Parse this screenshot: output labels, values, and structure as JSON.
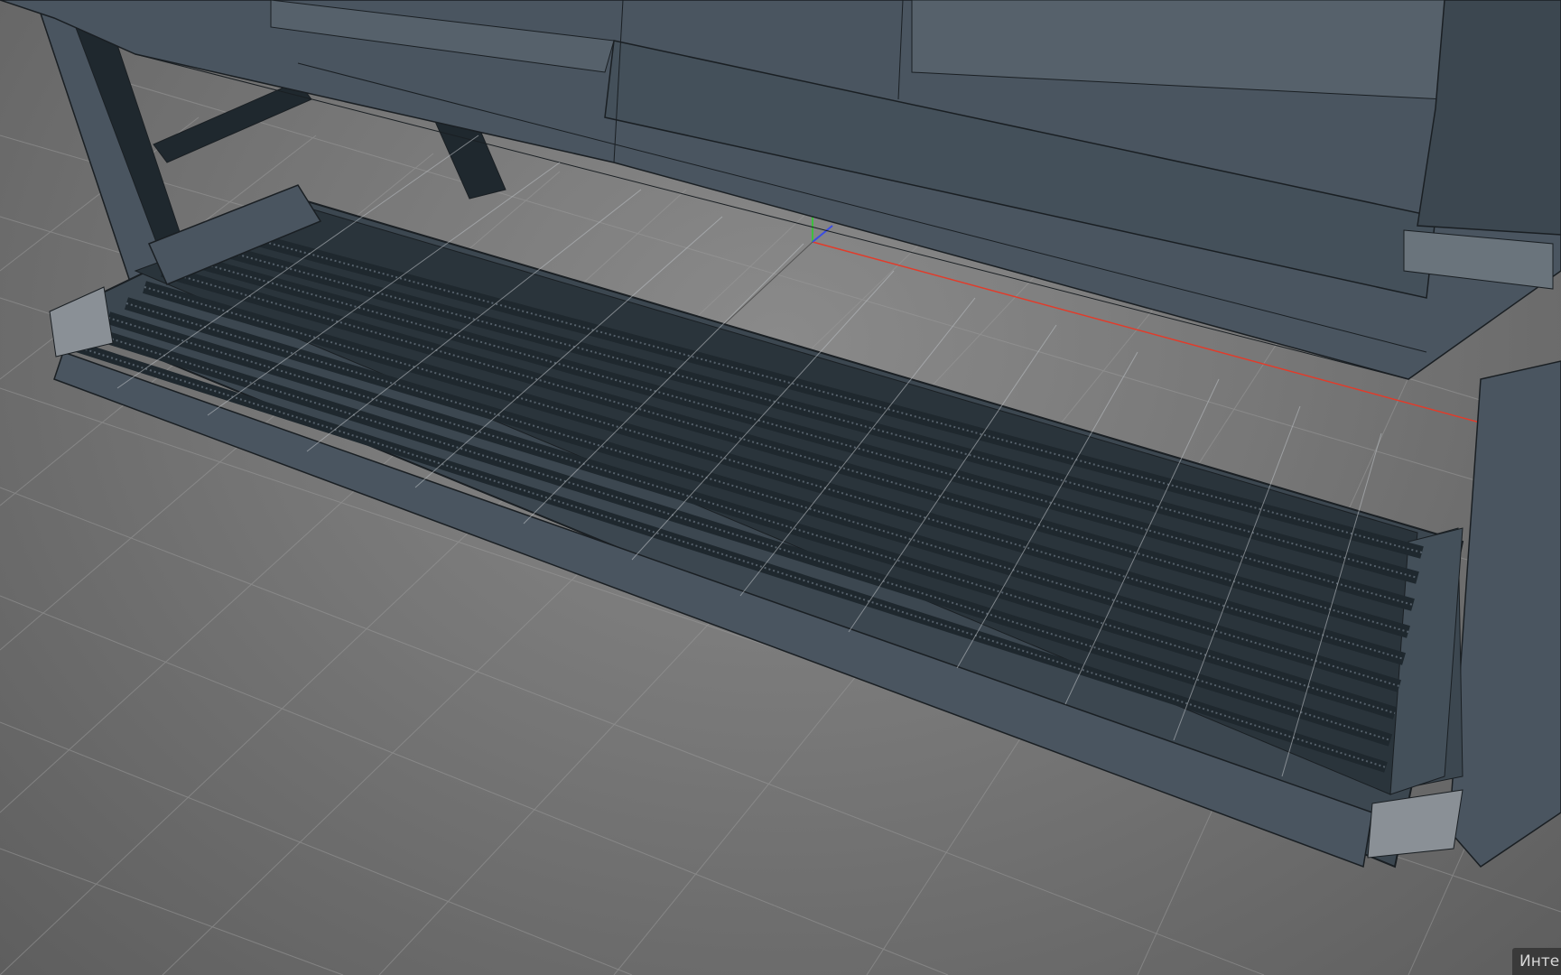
{
  "app": {
    "viewport": {
      "background_color": "#7a7a7a",
      "mesh_color": "#4a5560",
      "mesh_dark_color": "#1f282e",
      "wire_color": "#1a1f23",
      "grid_color": "#9a9a9a",
      "axis": {
        "x_color": "#e23b2a",
        "y_color": "#3fbf3f",
        "z_color": "#3b4de2"
      }
    },
    "status": {
      "label": "Инте"
    },
    "icons": {
      "axis_gizmo": "axis-gizmo-icon"
    }
  }
}
